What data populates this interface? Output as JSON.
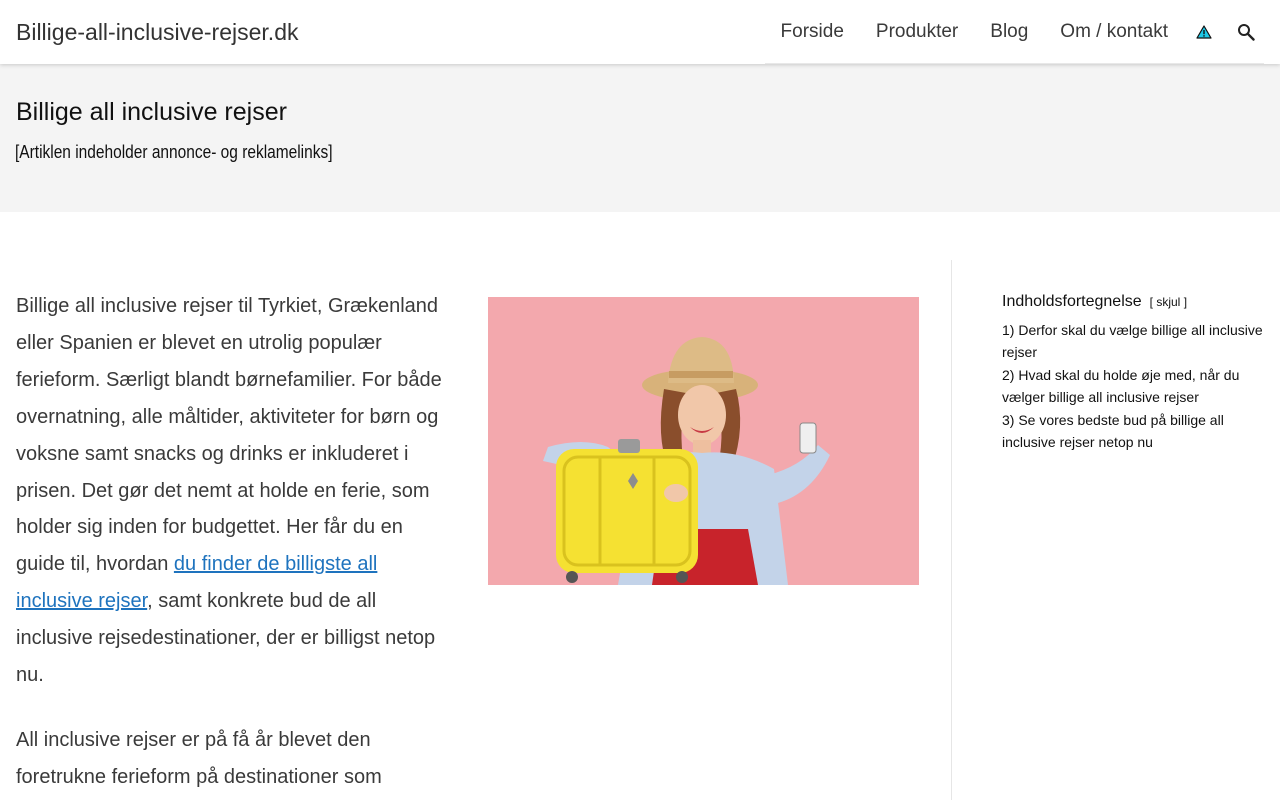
{
  "header": {
    "site_title": "Billige-all-inclusive-rejser.dk",
    "nav": [
      {
        "label": "Forside"
      },
      {
        "label": "Produkter"
      },
      {
        "label": "Blog"
      },
      {
        "label": "Om / kontakt"
      }
    ],
    "icons": {
      "alert": "warning-triangle-icon",
      "search": "search-icon"
    }
  },
  "title_band": {
    "title": "Billige all inclusive rejser",
    "disclaimer": "[Artiklen indeholder annonce- og reklamelinks]"
  },
  "article": {
    "intro_before_link": "Billige all inclusive rejser til Tyrkiet, Grækenland eller Spanien er blevet en utrolig populær ferieform. Særligt blandt børnefamilier. For både overnatning, alle måltider, aktiviteter for børn og voksne samt snacks og drinks er inkluderet i prisen. Det gør det nemt at holde en ferie, som holder sig inden for budgettet. Her får du en guide til, hvordan ",
    "intro_link": "du finder de billigste all inclusive rejser",
    "intro_after_link": ", samt konkrete bud de all inclusive rejsedestinationer, der er billigst netop nu.",
    "second_para": "All inclusive rejser er på få år blevet den foretrukne ferieform på destinationer som"
  },
  "toc": {
    "title": "Indholdsfortegnelse",
    "toggle_open": "[",
    "toggle_label": "skjul",
    "toggle_close": "]",
    "items": [
      {
        "num": "1)",
        "label": "Derfor skal du vælge billige all inclusive rejser"
      },
      {
        "num": "2)",
        "label": "Hvad skal du holde øje med, når du vælger billige all inclusive rejser"
      },
      {
        "num": "3)",
        "label": "Se vores bedste bud på billige all inclusive rejser netop nu"
      }
    ]
  },
  "colors": {
    "link": "#1e73be",
    "hero_background": "#f2a9ae",
    "title_band": "#f4f4f4"
  }
}
